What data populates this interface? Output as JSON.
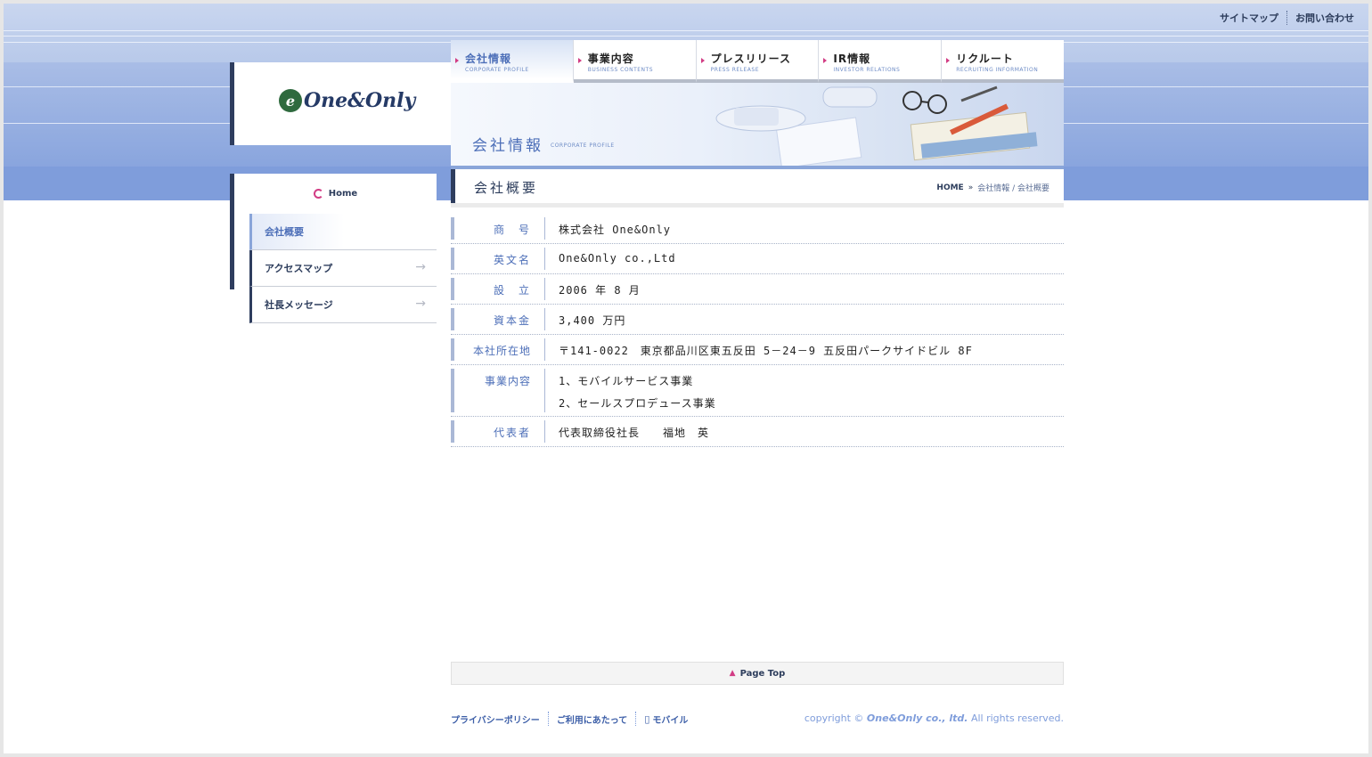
{
  "util_links": {
    "sitemap": "サイトマップ",
    "contact": "お問い合わせ"
  },
  "logo": {
    "text": "One&Only",
    "mark": "e"
  },
  "gnav": [
    {
      "jp": "会社情報",
      "en": "CORPORATE PROFILE"
    },
    {
      "jp": "事業内容",
      "en": "BUSINESS CONTENTS"
    },
    {
      "jp": "プレスリリース",
      "en": "PRESS RELEASE"
    },
    {
      "jp": "IR情報",
      "en": "INVESTOR RELATIONS"
    },
    {
      "jp": "リクルート",
      "en": "RECRUITING INFORMATION"
    }
  ],
  "hero": {
    "title": "会社情報",
    "title_en": "CORPORATE PROFILE"
  },
  "page": {
    "title": "会社概要",
    "breadcrumb": {
      "home": "HOME",
      "trail": "会社情報 / 会社概要"
    }
  },
  "side": {
    "home": "Home",
    "items": [
      {
        "label": "会社概要"
      },
      {
        "label": "アクセスマップ"
      },
      {
        "label": "社長メッセージ"
      }
    ]
  },
  "info": [
    {
      "label": "商　号",
      "values": [
        "株式会社 One&Only"
      ]
    },
    {
      "label": "英文名",
      "values": [
        "One&Only co.,Ltd"
      ]
    },
    {
      "label": "設　立",
      "values": [
        "2006 年 8 月"
      ]
    },
    {
      "label": "資本金",
      "values": [
        "3,400 万円"
      ]
    },
    {
      "label": "本社所在地",
      "values": [
        "〒141-0022　東京都品川区東五反田 5－24－9 五反田パークサイドビル 8F"
      ]
    },
    {
      "label": "事業内容",
      "values": [
        "1、モバイルサービス事業",
        "2、セールスプロデュース事業"
      ]
    },
    {
      "label": "代表者",
      "values": [
        "代表取締役社長　　福地　英"
      ]
    }
  ],
  "pagetop": "Page Top",
  "footer": {
    "links": [
      "プライバシーポリシー",
      "ご利用にあたって",
      "モバイル"
    ],
    "copyright_prefix": "copyright © ",
    "copyright_company": "One&Only co., ltd.",
    "copyright_suffix": " All rights reserved."
  },
  "colors": {
    "accent": "#4d6fb8",
    "navy": "#2e3d5e",
    "pink": "#d23c84",
    "band": "#7f9ddb"
  }
}
